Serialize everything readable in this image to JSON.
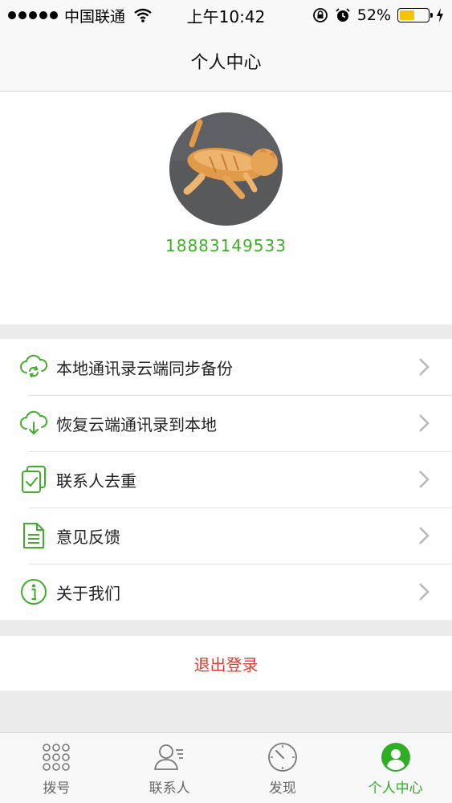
{
  "status_bar": {
    "carrier": "中国联通",
    "time": "上午10:42",
    "battery_percent": "52%",
    "battery_level": 0.52
  },
  "nav": {
    "title": "个人中心"
  },
  "profile": {
    "phone": "18883149533"
  },
  "menu": {
    "items": [
      {
        "label": "本地通讯录云端同步备份",
        "icon": "cloud-sync-icon"
      },
      {
        "label": "恢复云端通讯录到本地",
        "icon": "cloud-download-icon"
      },
      {
        "label": "联系人去重",
        "icon": "dedupe-icon"
      },
      {
        "label": "意见反馈",
        "icon": "document-icon"
      },
      {
        "label": "关于我们",
        "icon": "info-icon"
      }
    ]
  },
  "logout": {
    "label": "退出登录"
  },
  "tabs": [
    {
      "label": "拨号",
      "icon": "dialpad-icon",
      "active": false
    },
    {
      "label": "联系人",
      "icon": "contacts-icon",
      "active": false
    },
    {
      "label": "发现",
      "icon": "compass-icon",
      "active": false
    },
    {
      "label": "个人中心",
      "icon": "profile-icon",
      "active": true
    }
  ],
  "colors": {
    "accent": "#3fae2a",
    "danger": "#e8372d",
    "background": "#ebebeb"
  }
}
